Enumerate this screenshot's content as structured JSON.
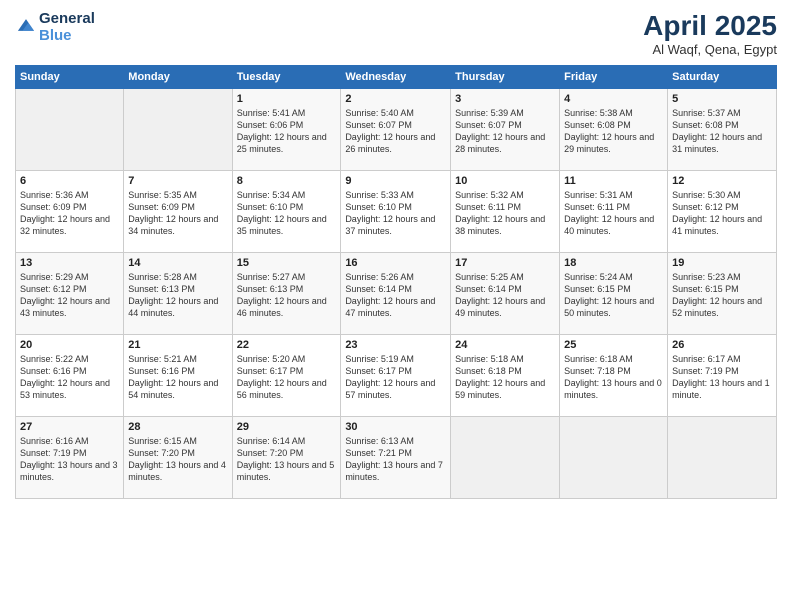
{
  "logo": {
    "line1": "General",
    "line2": "Blue"
  },
  "title": "April 2025",
  "subtitle": "Al Waqf, Qena, Egypt",
  "header_days": [
    "Sunday",
    "Monday",
    "Tuesday",
    "Wednesday",
    "Thursday",
    "Friday",
    "Saturday"
  ],
  "weeks": [
    [
      {
        "day": "",
        "info": ""
      },
      {
        "day": "",
        "info": ""
      },
      {
        "day": "1",
        "info": "Sunrise: 5:41 AM\nSunset: 6:06 PM\nDaylight: 12 hours and 25 minutes."
      },
      {
        "day": "2",
        "info": "Sunrise: 5:40 AM\nSunset: 6:07 PM\nDaylight: 12 hours and 26 minutes."
      },
      {
        "day": "3",
        "info": "Sunrise: 5:39 AM\nSunset: 6:07 PM\nDaylight: 12 hours and 28 minutes."
      },
      {
        "day": "4",
        "info": "Sunrise: 5:38 AM\nSunset: 6:08 PM\nDaylight: 12 hours and 29 minutes."
      },
      {
        "day": "5",
        "info": "Sunrise: 5:37 AM\nSunset: 6:08 PM\nDaylight: 12 hours and 31 minutes."
      }
    ],
    [
      {
        "day": "6",
        "info": "Sunrise: 5:36 AM\nSunset: 6:09 PM\nDaylight: 12 hours and 32 minutes."
      },
      {
        "day": "7",
        "info": "Sunrise: 5:35 AM\nSunset: 6:09 PM\nDaylight: 12 hours and 34 minutes."
      },
      {
        "day": "8",
        "info": "Sunrise: 5:34 AM\nSunset: 6:10 PM\nDaylight: 12 hours and 35 minutes."
      },
      {
        "day": "9",
        "info": "Sunrise: 5:33 AM\nSunset: 6:10 PM\nDaylight: 12 hours and 37 minutes."
      },
      {
        "day": "10",
        "info": "Sunrise: 5:32 AM\nSunset: 6:11 PM\nDaylight: 12 hours and 38 minutes."
      },
      {
        "day": "11",
        "info": "Sunrise: 5:31 AM\nSunset: 6:11 PM\nDaylight: 12 hours and 40 minutes."
      },
      {
        "day": "12",
        "info": "Sunrise: 5:30 AM\nSunset: 6:12 PM\nDaylight: 12 hours and 41 minutes."
      }
    ],
    [
      {
        "day": "13",
        "info": "Sunrise: 5:29 AM\nSunset: 6:12 PM\nDaylight: 12 hours and 43 minutes."
      },
      {
        "day": "14",
        "info": "Sunrise: 5:28 AM\nSunset: 6:13 PM\nDaylight: 12 hours and 44 minutes."
      },
      {
        "day": "15",
        "info": "Sunrise: 5:27 AM\nSunset: 6:13 PM\nDaylight: 12 hours and 46 minutes."
      },
      {
        "day": "16",
        "info": "Sunrise: 5:26 AM\nSunset: 6:14 PM\nDaylight: 12 hours and 47 minutes."
      },
      {
        "day": "17",
        "info": "Sunrise: 5:25 AM\nSunset: 6:14 PM\nDaylight: 12 hours and 49 minutes."
      },
      {
        "day": "18",
        "info": "Sunrise: 5:24 AM\nSunset: 6:15 PM\nDaylight: 12 hours and 50 minutes."
      },
      {
        "day": "19",
        "info": "Sunrise: 5:23 AM\nSunset: 6:15 PM\nDaylight: 12 hours and 52 minutes."
      }
    ],
    [
      {
        "day": "20",
        "info": "Sunrise: 5:22 AM\nSunset: 6:16 PM\nDaylight: 12 hours and 53 minutes."
      },
      {
        "day": "21",
        "info": "Sunrise: 5:21 AM\nSunset: 6:16 PM\nDaylight: 12 hours and 54 minutes."
      },
      {
        "day": "22",
        "info": "Sunrise: 5:20 AM\nSunset: 6:17 PM\nDaylight: 12 hours and 56 minutes."
      },
      {
        "day": "23",
        "info": "Sunrise: 5:19 AM\nSunset: 6:17 PM\nDaylight: 12 hours and 57 minutes."
      },
      {
        "day": "24",
        "info": "Sunrise: 5:18 AM\nSunset: 6:18 PM\nDaylight: 12 hours and 59 minutes."
      },
      {
        "day": "25",
        "info": "Sunrise: 6:18 AM\nSunset: 7:18 PM\nDaylight: 13 hours and 0 minutes."
      },
      {
        "day": "26",
        "info": "Sunrise: 6:17 AM\nSunset: 7:19 PM\nDaylight: 13 hours and 1 minute."
      }
    ],
    [
      {
        "day": "27",
        "info": "Sunrise: 6:16 AM\nSunset: 7:19 PM\nDaylight: 13 hours and 3 minutes."
      },
      {
        "day": "28",
        "info": "Sunrise: 6:15 AM\nSunset: 7:20 PM\nDaylight: 13 hours and 4 minutes."
      },
      {
        "day": "29",
        "info": "Sunrise: 6:14 AM\nSunset: 7:20 PM\nDaylight: 13 hours and 5 minutes."
      },
      {
        "day": "30",
        "info": "Sunrise: 6:13 AM\nSunset: 7:21 PM\nDaylight: 13 hours and 7 minutes."
      },
      {
        "day": "",
        "info": ""
      },
      {
        "day": "",
        "info": ""
      },
      {
        "day": "",
        "info": ""
      }
    ]
  ]
}
